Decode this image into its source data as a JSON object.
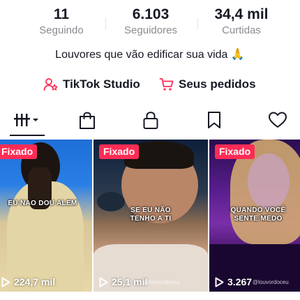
{
  "stats": {
    "following": {
      "value": "11",
      "label": "Seguindo"
    },
    "followers": {
      "value": "6.103",
      "label": "Seguidores"
    },
    "likes": {
      "value": "34,4 mil",
      "label": "Curtidas"
    }
  },
  "bio": "Louvores que vão edificar sua vida 🙏",
  "links": {
    "studio": {
      "label": "TikTok Studio",
      "icon": "person-star-icon"
    },
    "orders": {
      "label": "Seus pedidos",
      "icon": "cart-icon"
    }
  },
  "tabs": [
    {
      "name": "videos",
      "icon": "grid-bars-icon",
      "active": true
    },
    {
      "name": "shop",
      "icon": "shopping-bag-icon"
    },
    {
      "name": "private",
      "icon": "lock-icon"
    },
    {
      "name": "saved",
      "icon": "bookmark-icon"
    },
    {
      "name": "liked",
      "icon": "heart-icon"
    }
  ],
  "videos": [
    {
      "pinned": "Fixado",
      "caption": "EU NAO DOU ALEM",
      "views": "224,7 mil",
      "handle": ""
    },
    {
      "pinned": "Fixado",
      "caption_line1": "SE EU NÃO",
      "caption_line2": "TENHO A TI",
      "views": "25,1 mil",
      "handle": "@louvordoceu"
    },
    {
      "pinned": "Fixado",
      "caption_line1": "QUANDO VOCÊ",
      "caption_line2": "SENTE MEDO",
      "views": "3.267",
      "handle": "@louvordoceu"
    }
  ],
  "colors": {
    "accent": "#fe2c55",
    "text": "#161823",
    "muted": "#8a8b91"
  }
}
